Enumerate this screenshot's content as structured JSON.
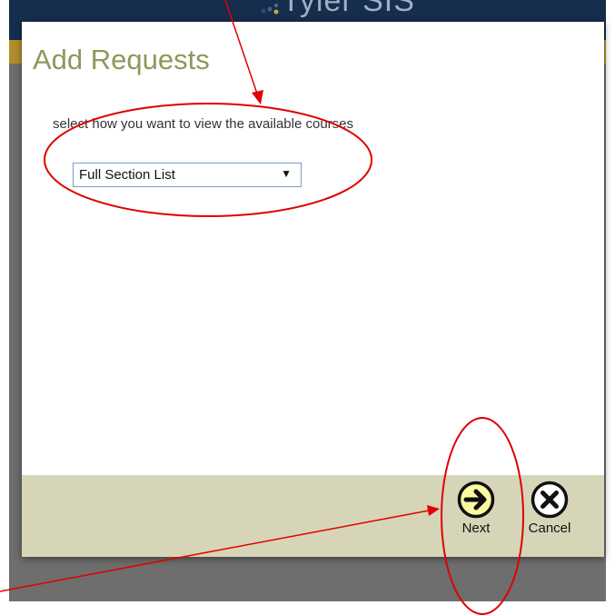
{
  "app": {
    "logo_text": "Tyler SIS"
  },
  "dialog": {
    "title": "Add Requests",
    "instruction": "select how you want to view the available courses",
    "view_select": {
      "selected": "Full Section List"
    },
    "footer": {
      "next_label": "Next",
      "cancel_label": "Cancel"
    }
  },
  "colors": {
    "title": "#8a9a5b",
    "footer_bg": "#d6d5b8",
    "next_icon_fill": "#fafa9e",
    "annotation_red": "#e00000",
    "header_navy": "#162d4d",
    "header_gold": "#b48d2c"
  },
  "icons": {
    "next": "arrow-right-circle-icon",
    "cancel": "x-circle-icon",
    "select_arrow": "triangle-down-icon"
  }
}
